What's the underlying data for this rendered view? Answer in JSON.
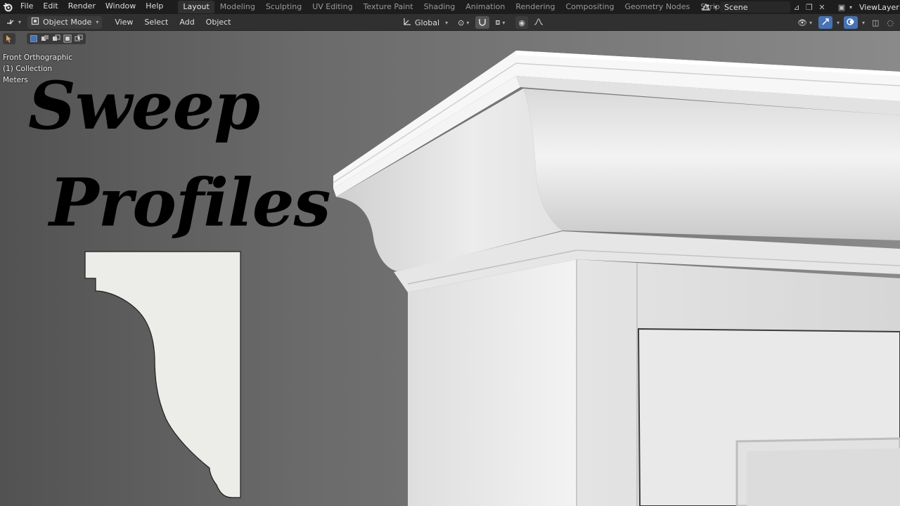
{
  "topbar": {
    "menus": [
      "File",
      "Edit",
      "Render",
      "Window",
      "Help"
    ],
    "workspaces": [
      "Layout",
      "Modeling",
      "Sculpting",
      "UV Editing",
      "Texture Paint",
      "Shading",
      "Animation",
      "Rendering",
      "Compositing",
      "Geometry Nodes",
      "Scripting"
    ],
    "active_workspace": "Layout",
    "add_tab": "+",
    "scene_name": "Scene",
    "view_layer": "ViewLayer"
  },
  "viewport_header": {
    "mode": "Object Mode",
    "menus": [
      "View",
      "Select",
      "Add",
      "Object"
    ],
    "transform_orientation": "Global"
  },
  "viewport": {
    "view_name": "Front Orthographic",
    "collection": "(1) Collection",
    "units": "Meters",
    "title_line1": "Sweep",
    "title_line2": "Profiles"
  },
  "colors": {
    "accent_blue": "#4772b3",
    "profile_fill": "#ececea",
    "molding_white": "#f2f2f2"
  }
}
